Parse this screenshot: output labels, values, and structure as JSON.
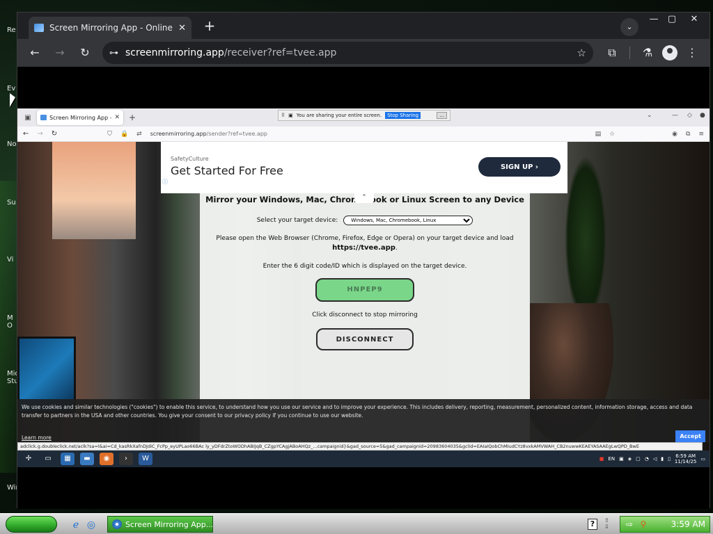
{
  "desktop": {
    "labels": [
      "Re",
      "Ev",
      "No",
      "Su",
      "Vi",
      "M\nO",
      "Micro\nStu",
      "Win"
    ]
  },
  "chrome": {
    "tab_title": "Screen Mirroring App - Online Recei",
    "tab_close": "✕",
    "new_tab": "+",
    "tab_search": "⌄",
    "minimize": "—",
    "maximize": "▢",
    "close": "✕",
    "back": "←",
    "forward": "→",
    "reload": "↻",
    "site_info": "⊶",
    "url_host": "screenmirroring.app",
    "url_path": "/receiver?ref=tvee.app",
    "bookmark": "☆",
    "extensions": "⧉",
    "labs": "⚗",
    "menu": "⋮"
  },
  "remote_browser": {
    "tab_title": "Screen Mirroring App - Sen",
    "tab_close": "✕",
    "new_tab": "+",
    "url_host": "screenmirroring.app",
    "url_path": "/sender?ref=tvee.app",
    "back": "←",
    "forward": "→",
    "reload": "↻"
  },
  "share_bar": {
    "message": "You are sharing your entire screen.",
    "stop_label": "Stop Sharing",
    "minimize_label": "..."
  },
  "ad": {
    "brand": "SafetyCulture",
    "headline": "Get Started For Free",
    "cta": "SIGN UP",
    "info": "ⓘ"
  },
  "main": {
    "headline": "Mirror your Windows, Mac, Chromebook or Linux Screen to any Device",
    "collapse_arrow": "⌃",
    "target_label": "Select your target device:",
    "target_selected": "Windows, Mac, Chromebook, Linux",
    "instruction_text": "Please open the Web Browser (Chrome, Firefox, Edge or Opera) on your target device and load",
    "instruction_link": "https://tvee.app",
    "code_label": "Enter the 6 digit code/ID which is displayed on the target device.",
    "code_value": "HNPEP9",
    "stop_text": "Click disconnect to stop mirroring",
    "disconnect_label": "DISCONNECT",
    "info_icon": "ⓘ"
  },
  "cookie": {
    "text": "We use cookies and similar technologies (\"cookies\") to enable this service, to understand how you use our service and to improve your experience. This includes delivery, reporting, measurement, personalized content, information storage, access and data transfer to partners in the USA and other countries. You give your consent to our privacy policy if you continue to use our website.",
    "learn_more": "Learn more",
    "accept": "Accept"
  },
  "status_url": "adclick.g.doubleclick.net/aclk?sa=l&ai=Cd_kasRkXafnDJdiC_FcPp_eyUPLao66BAc ly_yDFdrZtoWODhABIJqB_CZgpYCAgjABoAHQz_...campaignid}&gad_source=5&gad_campaignid=20983604035&gclid=EAIaIQobChMIudCYz8vxkAMVWAH_CB2nuwwKEAEYASAAEgLwQPD_BwE",
  "remote_taskbar": {
    "lang": "EN",
    "time": "6:59 AM",
    "date": "11/14/25"
  },
  "xp_taskbar": {
    "task_label": "Screen Mirroring App...",
    "help": "?",
    "clock": "3:59 AM"
  }
}
